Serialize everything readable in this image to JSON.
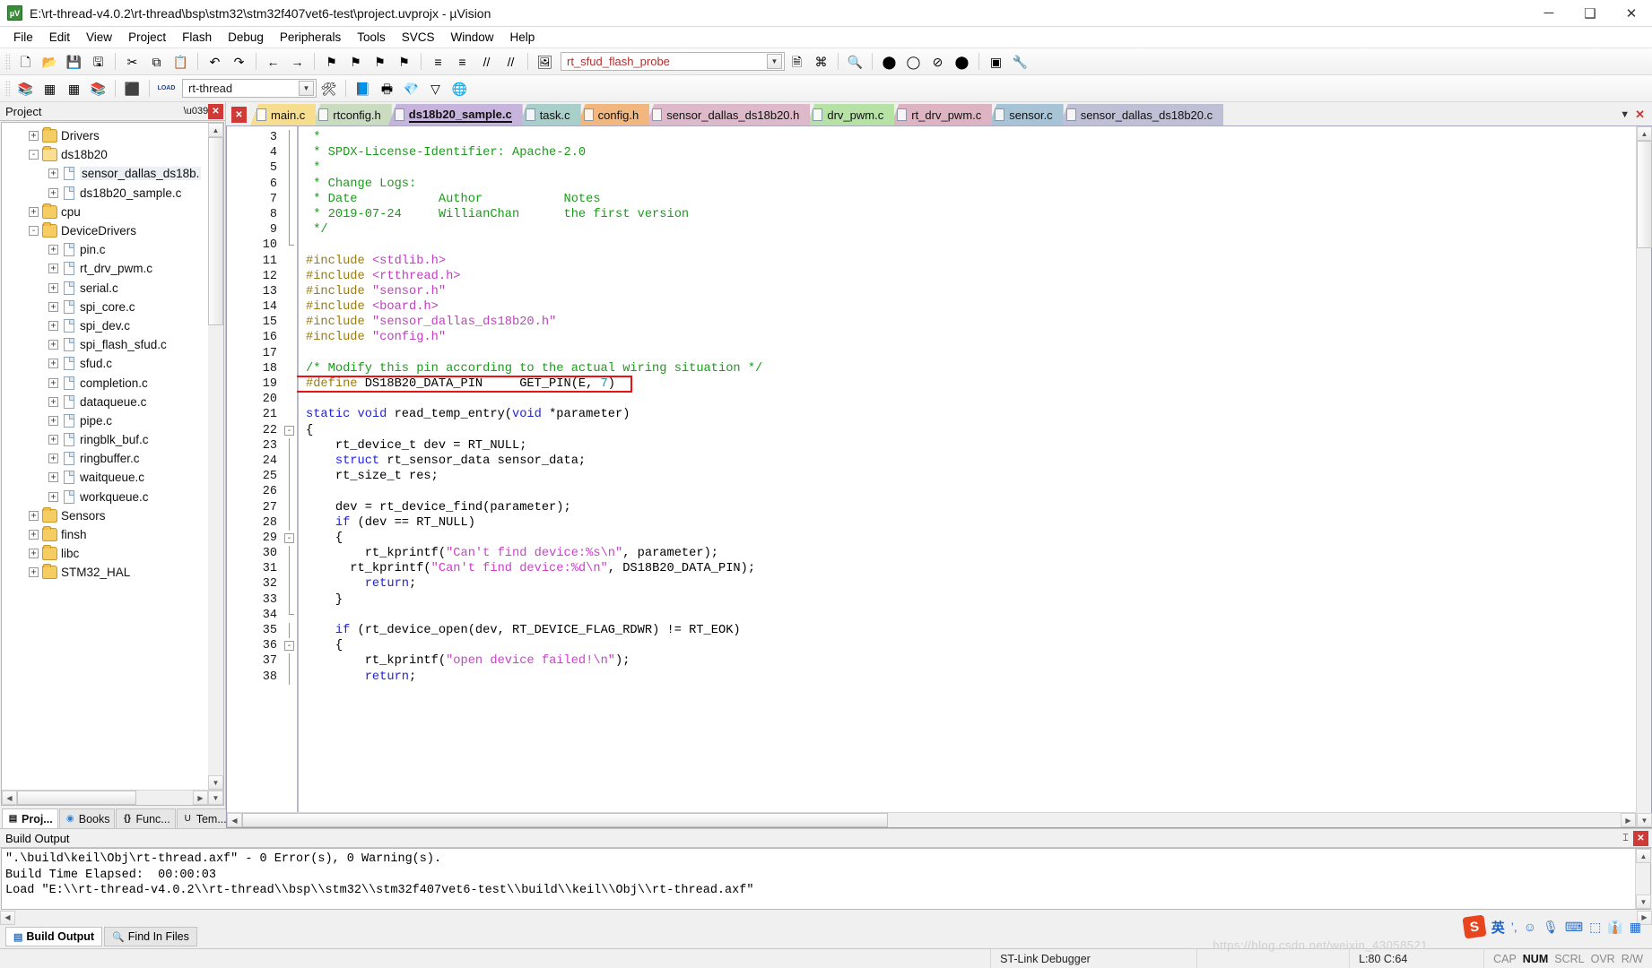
{
  "window": {
    "title": "E:\\rt-thread-v4.0.2\\rt-thread\\bsp\\stm32\\stm32f407vet6-test\\project.uvprojx - µVision",
    "app_icon": "uvision-icon",
    "minimize": "─",
    "maximize": "❑",
    "close": "✕"
  },
  "menubar": [
    {
      "label": "File"
    },
    {
      "label": "Edit"
    },
    {
      "label": "View"
    },
    {
      "label": "Project"
    },
    {
      "label": "Flash"
    },
    {
      "label": "Debug"
    },
    {
      "label": "Peripherals"
    },
    {
      "label": "Tools"
    },
    {
      "label": "SVCS"
    },
    {
      "label": "Window"
    },
    {
      "label": "Help"
    }
  ],
  "toolbar1": {
    "buttons": [
      {
        "name": "new-file-icon",
        "glyph": "🗋"
      },
      {
        "name": "open-file-icon",
        "glyph": "📂"
      },
      {
        "name": "save-icon",
        "glyph": "💾"
      },
      {
        "name": "save-all-icon",
        "glyph": "🖫"
      },
      {
        "name": "cut-icon",
        "glyph": "✂"
      },
      {
        "name": "copy-icon",
        "glyph": "⧉"
      },
      {
        "name": "paste-icon",
        "glyph": "📋"
      },
      {
        "name": "undo-icon",
        "glyph": "↶"
      },
      {
        "name": "redo-icon",
        "glyph": "↷"
      },
      {
        "name": "navigate-back-icon",
        "glyph": "←"
      },
      {
        "name": "navigate-forward-icon",
        "glyph": "→"
      },
      {
        "name": "bookmark-toggle-icon",
        "glyph": "⚑"
      },
      {
        "name": "bookmark-prev-icon",
        "glyph": "⚑"
      },
      {
        "name": "bookmark-next-icon",
        "glyph": "⚑"
      },
      {
        "name": "bookmark-clear-icon",
        "glyph": "⚑"
      },
      {
        "name": "indent-icon",
        "glyph": "≡"
      },
      {
        "name": "outdent-icon",
        "glyph": "≡"
      },
      {
        "name": "comment-icon",
        "glyph": "//"
      },
      {
        "name": "uncomment-icon",
        "glyph": "//"
      },
      {
        "name": "build-target-icon",
        "glyph": "🖼"
      }
    ],
    "search_value": "rt_sfud_flash_probe",
    "search_placeholder": "",
    "after_buttons": [
      {
        "name": "find-in-files-icon",
        "glyph": "🗎"
      },
      {
        "name": "goto-definition-icon",
        "glyph": "⌘"
      },
      {
        "name": "browse-symbol-icon",
        "glyph": "🔍"
      },
      {
        "name": "breakpoint-icon",
        "glyph": "⬤"
      },
      {
        "name": "breakpoint-disable-icon",
        "glyph": "◯"
      },
      {
        "name": "breakpoint-kill-all-icon",
        "glyph": "⊘"
      },
      {
        "name": "breakpoint-enable-icon",
        "glyph": "⬤"
      },
      {
        "name": "window-layout-icon",
        "glyph": "▣"
      },
      {
        "name": "configuration-wizard-icon",
        "glyph": "🔧"
      }
    ]
  },
  "toolbar2": {
    "buttons": [
      {
        "name": "translate-icon",
        "glyph": "📚"
      },
      {
        "name": "build-icon",
        "glyph": "▦"
      },
      {
        "name": "rebuild-icon",
        "glyph": "▦"
      },
      {
        "name": "batch-build-icon",
        "glyph": "📚"
      },
      {
        "name": "stop-build-icon",
        "glyph": "⬛"
      },
      {
        "name": "download-icon",
        "glyph": "LOAD"
      }
    ],
    "target_value": "rt-thread",
    "after_buttons": [
      {
        "name": "target-options-icon",
        "glyph": "🛠"
      },
      {
        "name": "manage-project-items-icon",
        "glyph": "📘"
      },
      {
        "name": "manage-run-time-icon",
        "glyph": "🖶"
      },
      {
        "name": "packs-icon",
        "glyph": "💎"
      },
      {
        "name": "filter-icon",
        "glyph": "▽"
      },
      {
        "name": "pack-installer-icon",
        "glyph": "🌐"
      }
    ]
  },
  "project_pane": {
    "header": "Project",
    "pin_icon": "pin-icon",
    "close_icon": "close-icon",
    "tree": [
      {
        "label": "Drivers",
        "indent": 1,
        "type": "folder",
        "expander": "+"
      },
      {
        "label": "ds18b20",
        "indent": 1,
        "type": "folder-open",
        "expander": "-"
      },
      {
        "label": "sensor_dallas_ds18b.",
        "indent": 2,
        "type": "file",
        "expander": "+",
        "selected": true
      },
      {
        "label": "ds18b20_sample.c",
        "indent": 2,
        "type": "file",
        "expander": "+"
      },
      {
        "label": "cpu",
        "indent": 1,
        "type": "folder",
        "expander": "+"
      },
      {
        "label": "DeviceDrivers",
        "indent": 1,
        "type": "folder-gear",
        "expander": "-"
      },
      {
        "label": "pin.c",
        "indent": 2,
        "type": "file",
        "expander": "+"
      },
      {
        "label": "rt_drv_pwm.c",
        "indent": 2,
        "type": "file",
        "expander": "+"
      },
      {
        "label": "serial.c",
        "indent": 2,
        "type": "file",
        "expander": "+"
      },
      {
        "label": "spi_core.c",
        "indent": 2,
        "type": "file",
        "expander": "+"
      },
      {
        "label": "spi_dev.c",
        "indent": 2,
        "type": "file",
        "expander": "+"
      },
      {
        "label": "spi_flash_sfud.c",
        "indent": 2,
        "type": "file",
        "expander": "+"
      },
      {
        "label": "sfud.c",
        "indent": 2,
        "type": "file",
        "expander": "+"
      },
      {
        "label": "completion.c",
        "indent": 2,
        "type": "file",
        "expander": "+"
      },
      {
        "label": "dataqueue.c",
        "indent": 2,
        "type": "file",
        "expander": "+"
      },
      {
        "label": "pipe.c",
        "indent": 2,
        "type": "file",
        "expander": "+"
      },
      {
        "label": "ringblk_buf.c",
        "indent": 2,
        "type": "file",
        "expander": "+"
      },
      {
        "label": "ringbuffer.c",
        "indent": 2,
        "type": "file",
        "expander": "+"
      },
      {
        "label": "waitqueue.c",
        "indent": 2,
        "type": "file",
        "expander": "+"
      },
      {
        "label": "workqueue.c",
        "indent": 2,
        "type": "file",
        "expander": "+"
      },
      {
        "label": "Sensors",
        "indent": 1,
        "type": "folder",
        "expander": "+"
      },
      {
        "label": "finsh",
        "indent": 1,
        "type": "folder",
        "expander": "+"
      },
      {
        "label": "libc",
        "indent": 1,
        "type": "folder",
        "expander": "+"
      },
      {
        "label": "STM32_HAL",
        "indent": 1,
        "type": "folder",
        "expander": "+"
      }
    ],
    "tabs": [
      {
        "label": "Proj...",
        "icon": "project-icon",
        "active": true
      },
      {
        "label": "Books",
        "icon": "books-icon",
        "active": false
      },
      {
        "label": "Func...",
        "icon": "functions-icon",
        "active": false
      },
      {
        "label": "Tem...",
        "icon": "templates-icon",
        "active": false
      }
    ]
  },
  "editor": {
    "tabs": [
      {
        "label": "main.c",
        "color": "#f7dd8e",
        "active": false
      },
      {
        "label": "rtconfig.h",
        "color": "#c9dcc0",
        "active": false
      },
      {
        "label": "ds18b20_sample.c",
        "color": "#c6b4dd",
        "active": true
      },
      {
        "label": "task.c",
        "color": "#a8cfc9",
        "active": false
      },
      {
        "label": "config.h",
        "color": "#f2b77f",
        "active": false
      },
      {
        "label": "sensor_dallas_ds18b20.h",
        "color": "#ddb9c9",
        "active": false
      },
      {
        "label": "drv_pwm.c",
        "color": "#b6e2a6",
        "active": false
      },
      {
        "label": "rt_drv_pwm.c",
        "color": "#dfb4c2",
        "active": false
      },
      {
        "label": "sensor.c",
        "color": "#a7c4d6",
        "active": false
      },
      {
        "label": "sensor_dallas_ds18b20.c",
        "color": "#bfc0d6",
        "active": false
      }
    ],
    "tab_scroll_down": "▼",
    "tab_close": "✕",
    "first_line_number": 3,
    "lines": [
      {
        "n": 3,
        "fold": "bar",
        "tokens": [
          {
            "t": " *",
            "c": "cmt"
          }
        ]
      },
      {
        "n": 4,
        "fold": "bar",
        "tokens": [
          {
            "t": " * SPDX-License-Identifier: Apache-2.0",
            "c": "cmt"
          }
        ]
      },
      {
        "n": 5,
        "fold": "bar",
        "tokens": [
          {
            "t": " *",
            "c": "cmt"
          }
        ]
      },
      {
        "n": 6,
        "fold": "bar",
        "tokens": [
          {
            "t": " * Change Logs:",
            "c": "cmt"
          }
        ]
      },
      {
        "n": 7,
        "fold": "bar",
        "tokens": [
          {
            "t": " * Date           Author           Notes",
            "c": "cmt"
          }
        ]
      },
      {
        "n": 8,
        "fold": "bar",
        "tokens": [
          {
            "t": " * 2019-07-24     WillianChan      the first version",
            "c": "cmt"
          }
        ]
      },
      {
        "n": 9,
        "fold": "bar",
        "tokens": [
          {
            "t": " */",
            "c": "cmt"
          }
        ]
      },
      {
        "n": 10,
        "fold": "end",
        "tokens": [
          {
            "t": "",
            "c": ""
          }
        ]
      },
      {
        "n": 11,
        "fold": "",
        "tokens": [
          {
            "t": "#include ",
            "c": "pre"
          },
          {
            "t": "<stdlib.h>",
            "c": "inc"
          }
        ]
      },
      {
        "n": 12,
        "fold": "",
        "tokens": [
          {
            "t": "#include ",
            "c": "pre"
          },
          {
            "t": "<rtthread.h>",
            "c": "inc"
          }
        ]
      },
      {
        "n": 13,
        "fold": "",
        "tokens": [
          {
            "t": "#include ",
            "c": "pre"
          },
          {
            "t": "\"sensor.h\"",
            "c": "inc"
          }
        ]
      },
      {
        "n": 14,
        "fold": "",
        "tokens": [
          {
            "t": "#include ",
            "c": "pre"
          },
          {
            "t": "<board.h>",
            "c": "inc"
          }
        ]
      },
      {
        "n": 15,
        "fold": "",
        "tokens": [
          {
            "t": "#include ",
            "c": "pre"
          },
          {
            "t": "\"sensor_dallas_ds18b20.h\"",
            "c": "inc"
          }
        ]
      },
      {
        "n": 16,
        "fold": "",
        "tokens": [
          {
            "t": "#include ",
            "c": "pre"
          },
          {
            "t": "\"config.h\"",
            "c": "inc"
          }
        ]
      },
      {
        "n": 17,
        "fold": "",
        "tokens": [
          {
            "t": "",
            "c": ""
          }
        ]
      },
      {
        "n": 18,
        "fold": "",
        "tokens": [
          {
            "t": "/* Modify this pin according to the actual wiring situation */",
            "c": "cmt"
          }
        ]
      },
      {
        "n": 19,
        "fold": "",
        "highlight": true,
        "tokens": [
          {
            "t": "#define",
            "c": "pre"
          },
          {
            "t": " DS18B20_DATA_PIN     GET_PIN(E, ",
            "c": ""
          },
          {
            "t": "7",
            "c": "num"
          },
          {
            "t": ")",
            "c": ""
          }
        ]
      },
      {
        "n": 20,
        "fold": "",
        "tokens": [
          {
            "t": "",
            "c": ""
          }
        ]
      },
      {
        "n": 21,
        "fold": "",
        "tokens": [
          {
            "t": "static void",
            "c": "kw"
          },
          {
            "t": " read_temp_entry(",
            "c": ""
          },
          {
            "t": "void",
            "c": "kw"
          },
          {
            "t": " *parameter)",
            "c": ""
          }
        ]
      },
      {
        "n": 22,
        "fold": "minus",
        "tokens": [
          {
            "t": "{",
            "c": ""
          }
        ]
      },
      {
        "n": 23,
        "fold": "bar",
        "tokens": [
          {
            "t": "    rt_device_t dev = RT_NULL;",
            "c": ""
          }
        ]
      },
      {
        "n": 24,
        "fold": "bar",
        "tokens": [
          {
            "t": "    ",
            "c": ""
          },
          {
            "t": "struct",
            "c": "kw"
          },
          {
            "t": " rt_sensor_data sensor_data;",
            "c": ""
          }
        ]
      },
      {
        "n": 25,
        "fold": "bar",
        "tokens": [
          {
            "t": "    rt_size_t res;",
            "c": ""
          }
        ]
      },
      {
        "n": 26,
        "fold": "bar",
        "tokens": [
          {
            "t": "",
            "c": ""
          }
        ]
      },
      {
        "n": 27,
        "fold": "bar",
        "tokens": [
          {
            "t": "    dev = rt_device_find(parameter);",
            "c": ""
          }
        ]
      },
      {
        "n": 28,
        "fold": "bar",
        "tokens": [
          {
            "t": "    ",
            "c": ""
          },
          {
            "t": "if",
            "c": "kw"
          },
          {
            "t": " (dev == RT_NULL)",
            "c": ""
          }
        ]
      },
      {
        "n": 29,
        "fold": "minus",
        "tokens": [
          {
            "t": "    {",
            "c": ""
          }
        ]
      },
      {
        "n": 30,
        "fold": "bar",
        "tokens": [
          {
            "t": "        rt_kprintf(",
            "c": ""
          },
          {
            "t": "\"Can't find device:%s\\n\"",
            "c": "str"
          },
          {
            "t": ", parameter);",
            "c": ""
          }
        ]
      },
      {
        "n": 31,
        "fold": "bar",
        "tokens": [
          {
            "t": "      rt_kprintf(",
            "c": ""
          },
          {
            "t": "\"Can't find device:%d\\n\"",
            "c": "str"
          },
          {
            "t": ", DS18B20_DATA_PIN);",
            "c": ""
          }
        ]
      },
      {
        "n": 32,
        "fold": "bar",
        "tokens": [
          {
            "t": "        ",
            "c": ""
          },
          {
            "t": "return",
            "c": "kw"
          },
          {
            "t": ";",
            "c": ""
          }
        ]
      },
      {
        "n": 33,
        "fold": "bar",
        "tokens": [
          {
            "t": "    }",
            "c": ""
          }
        ]
      },
      {
        "n": 34,
        "fold": "end",
        "tokens": [
          {
            "t": "",
            "c": ""
          }
        ]
      },
      {
        "n": 35,
        "fold": "bar",
        "tokens": [
          {
            "t": "    ",
            "c": ""
          },
          {
            "t": "if",
            "c": "kw"
          },
          {
            "t": " (rt_device_open(dev, RT_DEVICE_FLAG_RDWR) != RT_EOK)",
            "c": ""
          }
        ]
      },
      {
        "n": 36,
        "fold": "minus",
        "tokens": [
          {
            "t": "    {",
            "c": ""
          }
        ]
      },
      {
        "n": 37,
        "fold": "bar",
        "tokens": [
          {
            "t": "        rt_kprintf(",
            "c": ""
          },
          {
            "t": "\"open device failed!\\n\"",
            "c": "str"
          },
          {
            "t": ");",
            "c": ""
          }
        ]
      },
      {
        "n": 38,
        "fold": "bar",
        "tokens": [
          {
            "t": "        ",
            "c": ""
          },
          {
            "t": "return",
            "c": "kw"
          },
          {
            "t": ";",
            "c": ""
          }
        ]
      }
    ],
    "highlight_color": "#ee1111"
  },
  "build_output": {
    "header": "Build Output",
    "pin_icon": "pin-icon",
    "close_icon": "close-icon",
    "lines": [
      "\".\\build\\keil\\Obj\\rt-thread.axf\" - 0 Error(s), 0 Warning(s).",
      "Build Time Elapsed:  00:00:03",
      "Load \"E:\\\\rt-thread-v4.0.2\\\\rt-thread\\\\bsp\\\\stm32\\\\stm32f407vet6-test\\\\build\\\\keil\\\\Obj\\\\rt-thread.axf\""
    ]
  },
  "bottom_tabs": [
    {
      "label": "Build Output",
      "icon": "build-output-icon",
      "active": true
    },
    {
      "label": "Find In Files",
      "icon": "find-in-files-icon",
      "active": false
    }
  ],
  "ime": {
    "logo": "S",
    "lang": "英",
    "items": [
      {
        "name": "punctuation-icon",
        "glyph": "’,"
      },
      {
        "name": "emoji-icon",
        "glyph": "☺"
      },
      {
        "name": "voice-input-icon",
        "glyph": "🎙"
      },
      {
        "name": "soft-keyboard-icon",
        "glyph": "⌨"
      },
      {
        "name": "screenshot-icon",
        "glyph": "⬚"
      },
      {
        "name": "skin-icon",
        "glyph": "👔"
      },
      {
        "name": "toolbox-icon",
        "glyph": "▦"
      }
    ]
  },
  "statusbar": {
    "debugger": "ST-Link Debugger",
    "cursor": "L:80 C:64",
    "flags": [
      {
        "label": "CAP",
        "on": false
      },
      {
        "label": "NUM",
        "on": true
      },
      {
        "label": "SCRL",
        "on": false
      },
      {
        "label": "OVR",
        "on": false
      },
      {
        "label": "R/W",
        "on": false
      }
    ]
  },
  "watermark": "https://blog.csdn.net/weixin_43058521"
}
